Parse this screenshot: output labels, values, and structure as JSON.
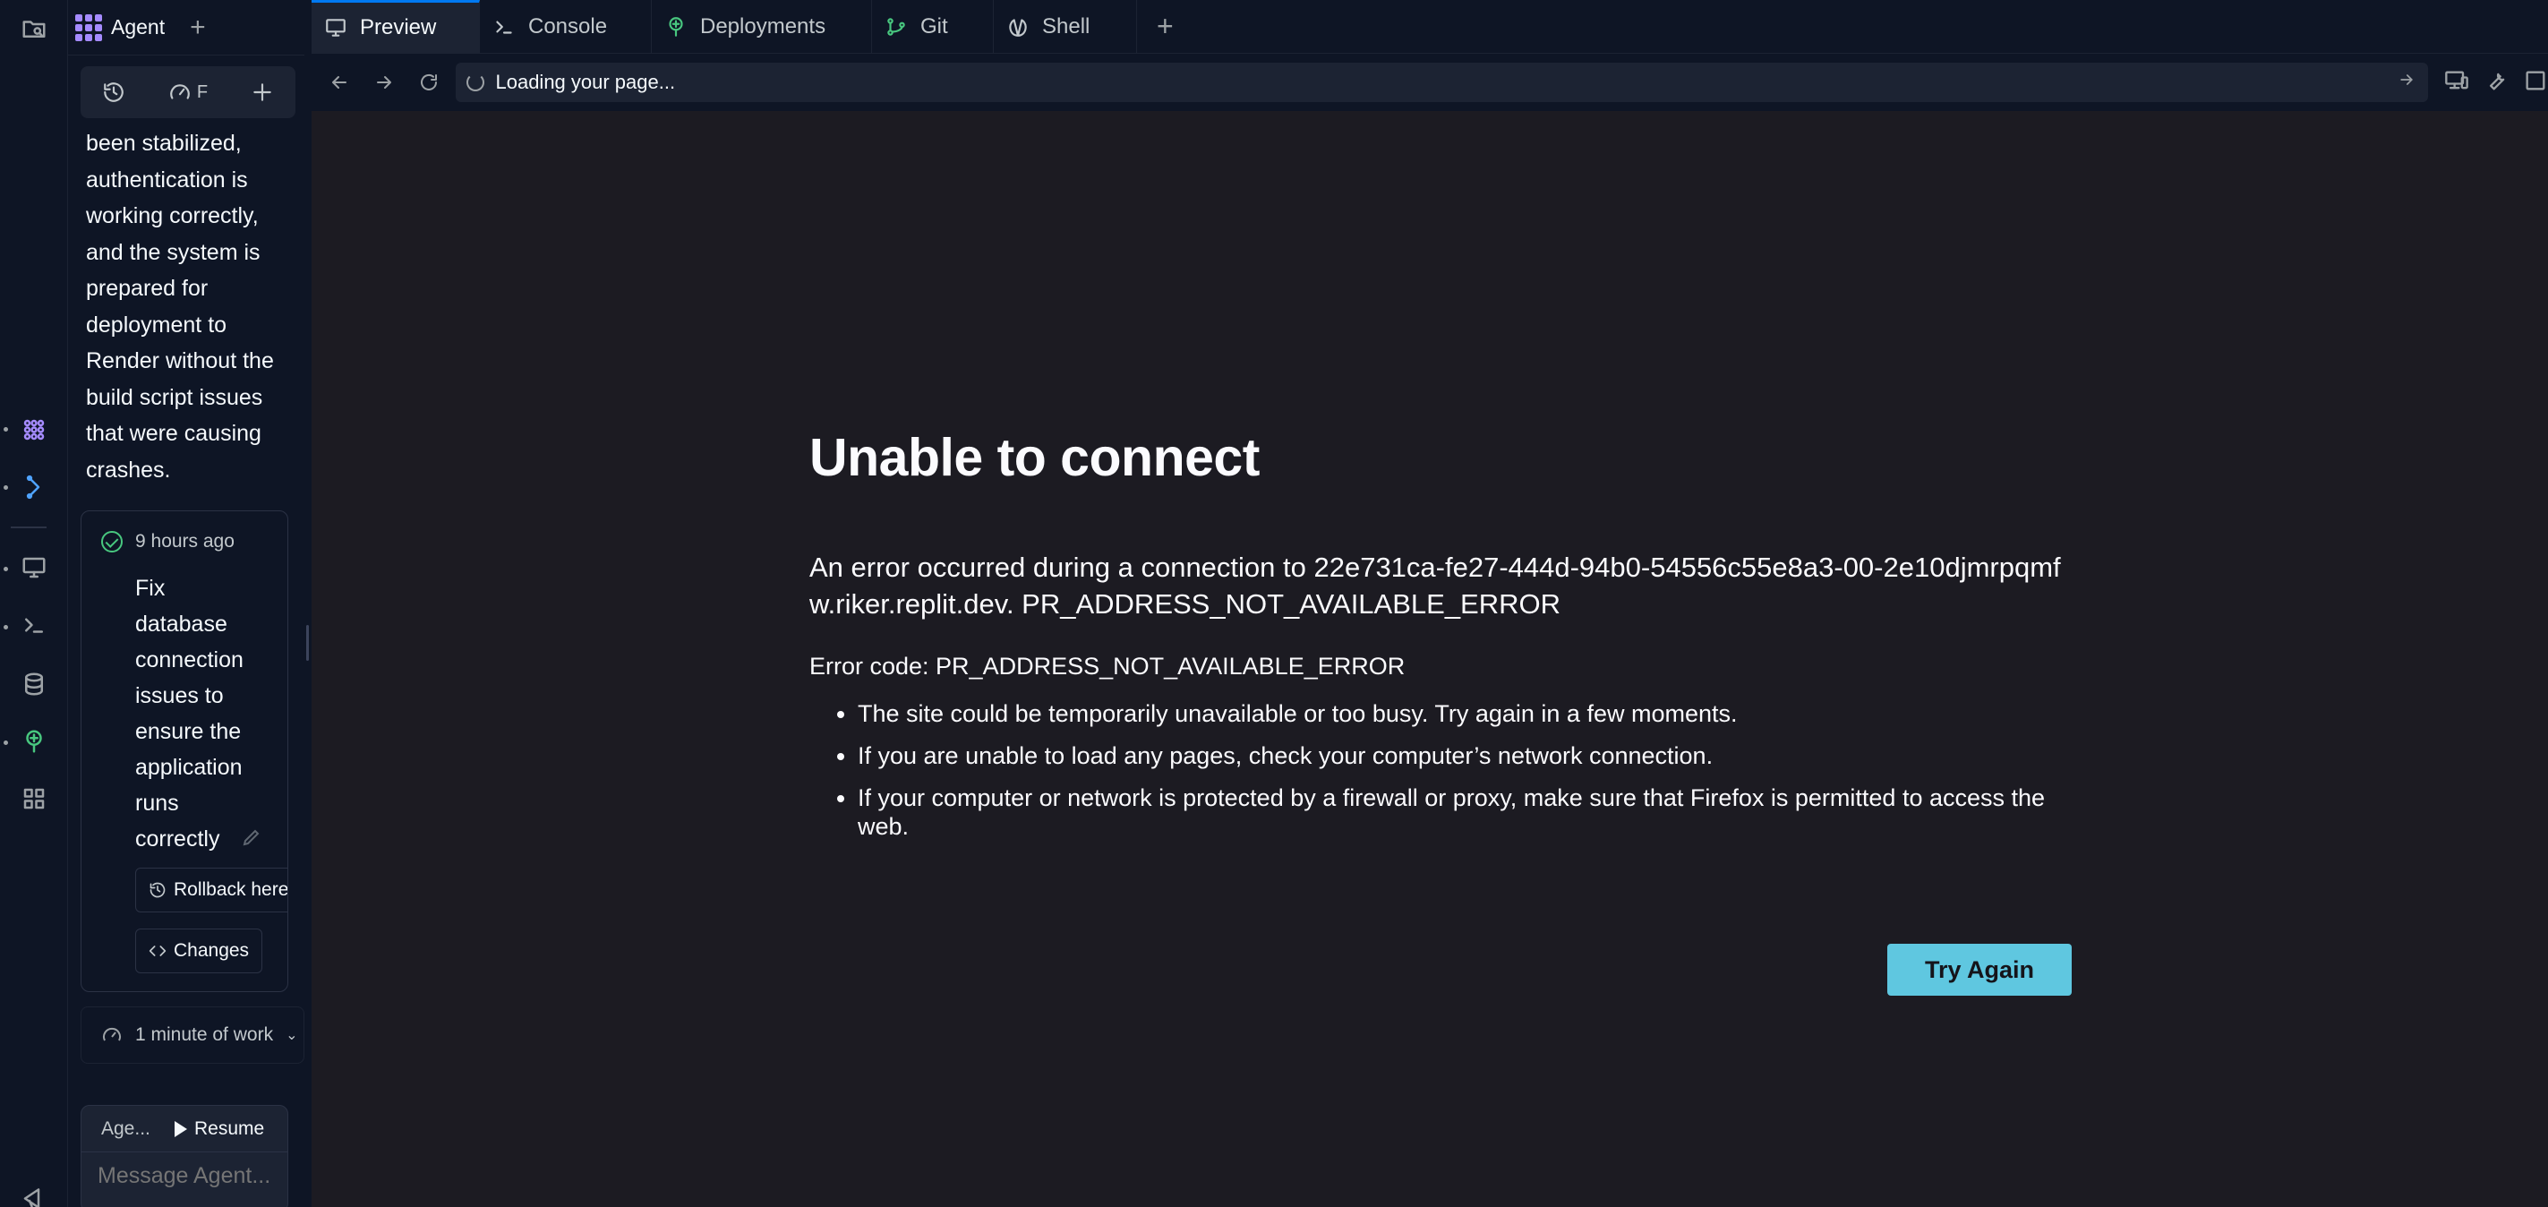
{
  "agent_panel": {
    "tab_label": "Agent",
    "tools_label": "F",
    "message_text": "been stabilized, authentication is working correctly, and the system is prepared for deployment to Render without the build script issues that were causing crashes.",
    "checkpoint": {
      "time": "9 hours ago",
      "description": "Fix database connection issues to ensure the application runs correctly",
      "rollback_label": "Rollback here",
      "changes_label": "Changes"
    },
    "work_summary": "1 minute of work",
    "composer": {
      "mode_label": "Age...",
      "resume_label": "Resume",
      "placeholder": "Message Agent..."
    }
  },
  "workspace_tabs": [
    {
      "label": "Preview",
      "icon": "monitor-icon"
    },
    {
      "label": "Console",
      "icon": "terminal-icon"
    },
    {
      "label": "Deployments",
      "icon": "deploy-icon"
    },
    {
      "label": "Git",
      "icon": "git-icon"
    },
    {
      "label": "Shell",
      "icon": "shell-icon"
    }
  ],
  "urlbar": {
    "status_text": "Loading your page..."
  },
  "error_page": {
    "title": "Unable to connect",
    "description": "An error occurred during a connection to 22e731ca-fe27-444d-94b0-54556c55e8a3-00-2e10djmrpqmfw.riker.replit.dev. PR_ADDRESS_NOT_AVAILABLE_ERROR",
    "error_code": "Error code: PR_ADDRESS_NOT_AVAILABLE_ERROR",
    "bullets": [
      "The site could be temporarily unavailable or too busy. Try again in a few moments.",
      "If you are unable to load any pages, check your computer’s network connection.",
      "If your computer or network is protected by a firewall or proxy, make sure that Firefox is permitted to access the web."
    ],
    "button_label": "Try Again"
  },
  "colors": {
    "background": "#0e1525",
    "panel": "#1c2333",
    "accent_tab": "#0079f2",
    "agent_logo": "#a58bff",
    "error_bg": "#1c1b22",
    "try_again_button": "#5fc7e0",
    "checkpoint_check": "#48c77f"
  }
}
